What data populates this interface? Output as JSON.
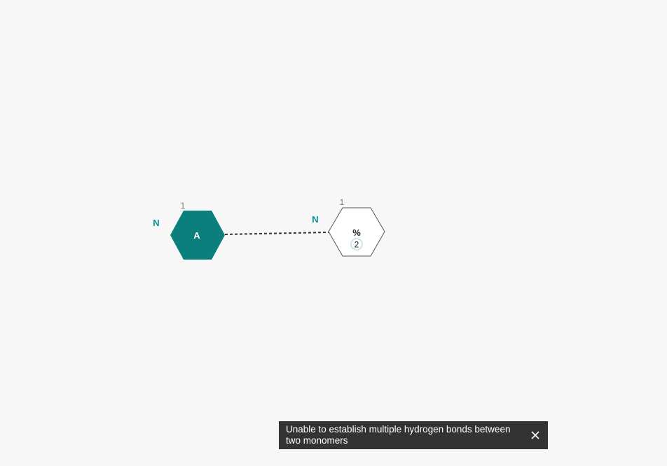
{
  "monomers": [
    {
      "id": "monomer-a",
      "label": "A",
      "index_label": "1",
      "side_label": "N",
      "filled": true,
      "fill_color": "#0b7f7b"
    },
    {
      "id": "monomer-percent",
      "label": "%",
      "badge": "2",
      "index_label": "1",
      "side_label": "N",
      "filled": false,
      "fill_color": "#ffffff"
    }
  ],
  "bond": {
    "type": "hydrogen",
    "style": "dashed"
  },
  "toast": {
    "message": "Unable to establish multiple hydrogen bonds between two monomers",
    "close_icon": "close-icon"
  },
  "colors": {
    "background": "#f7f7f8",
    "accent": "#0b7f7b",
    "label_teal": "#0f8f9a",
    "toast_bg": "#333333",
    "toast_text": "#ffffff"
  }
}
